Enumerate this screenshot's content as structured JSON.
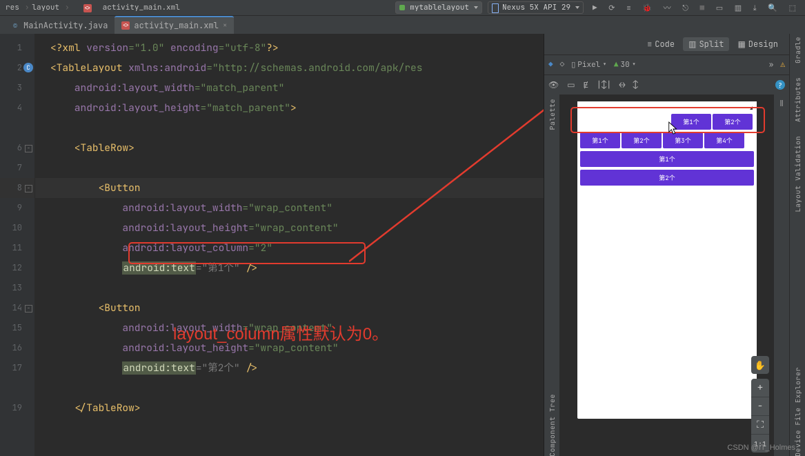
{
  "breadcrumb": {
    "p1": "res",
    "p2": "layout",
    "p3": "activity_main.xml"
  },
  "run_config": "mytablelayout",
  "device_target": "Nexus 5X API 29",
  "tabs": [
    {
      "label": "MainActivity.java",
      "active": false
    },
    {
      "label": "activity_main.xml",
      "active": true
    }
  ],
  "view_modes": {
    "code": "Code",
    "split": "Split",
    "design": "Design"
  },
  "design_toolbar": {
    "device": "Pixel",
    "api": "30"
  },
  "code": {
    "l1_a": "<?xml ",
    "l1_b": "version",
    "l1_c": "=\"1.0\" ",
    "l1_d": "encoding",
    "l1_e": "=\"utf-8\"",
    "l1_f": "?>",
    "l2_a": "<TableLayout ",
    "l2_b": "xmlns:android",
    "l2_c": "=\"http://schemas.android.com/apk/res",
    "l3_a": "    android:layout_width",
    "l3_b": "=\"match_parent\"",
    "l4_a": "    android:layout_height",
    "l4_b": "=\"match_parent\"",
    "l4_c": ">",
    "l6_a": "    <TableRow>",
    "l8_a": "        <Button",
    "l9_a": "            android:layout_width",
    "l9_b": "=\"wrap_content\"",
    "l10_a": "            android:layout_height",
    "l10_b": "=\"wrap_content\"",
    "l11_a": "            android:layout_column",
    "l11_b": "=\"2\"",
    "l12_a": "            ",
    "l12_b": "android:text",
    "l12_c": "=\"第1个\" ",
    "l12_d": "/>",
    "l14_a": "        <Button",
    "l15_a": "            android:layout_width",
    "l15_b": "=\"wrap_content\"",
    "l16_a": "            android:layout_height",
    "l16_b": "=\"wrap_content\"",
    "l17_a": "            ",
    "l17_b": "android:text",
    "l17_c": "=\"第2个\" ",
    "l17_d": "/>",
    "l19_a": "    </TableRow>"
  },
  "annotation": "layout_column属性默认为0。",
  "preview": {
    "row1": [
      {
        "t": "第1个"
      },
      {
        "t": "第2个"
      }
    ],
    "row2": [
      {
        "t": "第1个"
      },
      {
        "t": "第2个"
      },
      {
        "t": "第3个"
      },
      {
        "t": "第4个"
      }
    ],
    "row3": [
      {
        "t": "第1个"
      }
    ],
    "row4": [
      {
        "t": "第2个"
      }
    ]
  },
  "zoom": {
    "plus": "+",
    "minus": "−",
    "fit": "⛶",
    "oneone": "1:1"
  },
  "ribbons": {
    "gradle": "Gradle",
    "attrs": "Attributes",
    "layoutv": "Layout Validation",
    "palette": "Palette",
    "comptree": "Component Tree",
    "devfile": "Device File Explorer"
  },
  "watermark": "CSDN @IT_Holmes"
}
